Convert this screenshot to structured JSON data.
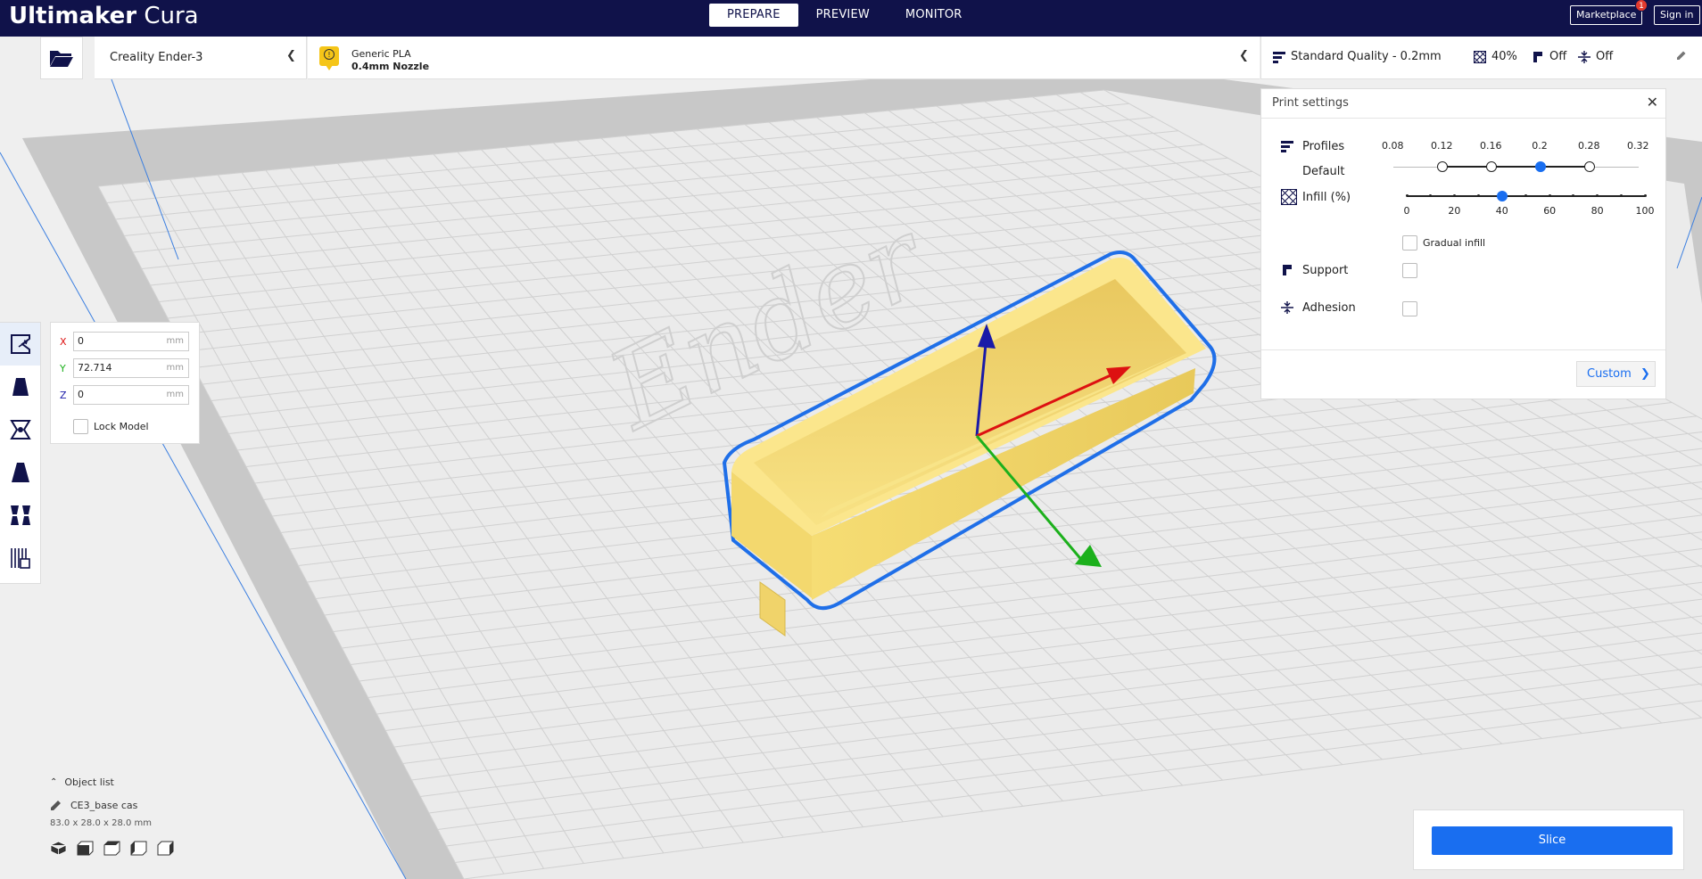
{
  "app": {
    "brand_bold": "Ultimaker",
    "brand_light": "Cura"
  },
  "stages": [
    {
      "label": "PREPARE",
      "active": true
    },
    {
      "label": "PREVIEW",
      "active": false
    },
    {
      "label": "MONITOR",
      "active": false
    }
  ],
  "top_right": {
    "marketplace": "Marketplace",
    "marketplace_badge": "1",
    "sign_in": "Sign in"
  },
  "printer": {
    "name": "Creality Ender-3"
  },
  "material": {
    "warning_badge": "!",
    "name": "Generic PLA",
    "nozzle": "0.4mm Nozzle"
  },
  "quality": {
    "profile": "Standard Quality - 0.2mm",
    "infill": "40%",
    "support": "Off",
    "adhesion": "Off"
  },
  "bed_logo_text": "Ender",
  "move_tool": {
    "x": {
      "label": "X",
      "value": "0",
      "unit": "mm"
    },
    "y": {
      "label": "Y",
      "value": "72.714",
      "unit": "mm"
    },
    "z": {
      "label": "Z",
      "value": "0",
      "unit": "mm"
    },
    "lock_label": "Lock Model"
  },
  "print_settings": {
    "title": "Print settings",
    "profiles_label": "Profiles",
    "profiles_sub": "Default",
    "profile_ticks": [
      "0.08",
      "0.12",
      "0.16",
      "0.2",
      "0.28",
      "0.32"
    ],
    "profile_selected": "0.2",
    "infill_label": "Infill (%)",
    "infill_ticks": [
      "0",
      "20",
      "40",
      "60",
      "80",
      "100"
    ],
    "infill_value": 40,
    "gradual_infill": "Gradual infill",
    "support_label": "Support",
    "adhesion_label": "Adhesion",
    "custom_label": "Custom"
  },
  "object_list": {
    "header": "Object list",
    "item_name": "CE3_base cas",
    "item_dims": "83.0 x 28.0 x 28.0 mm"
  },
  "slice_label": "Slice",
  "colors": {
    "topbar": "#10124a",
    "accent": "#196ef0",
    "model": "#f7e07a",
    "selection": "#1f6fe8"
  }
}
